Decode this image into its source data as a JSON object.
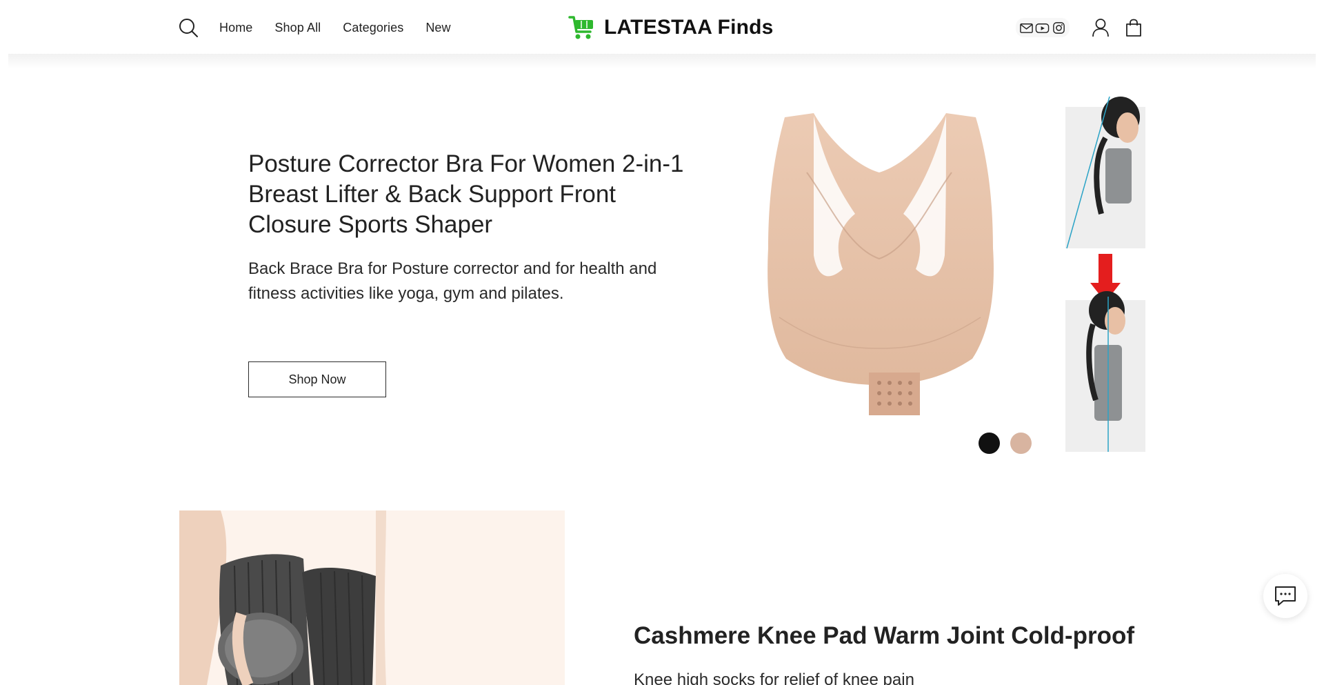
{
  "header": {
    "nav": [
      "Home",
      "Shop All",
      "Categories",
      "New"
    ],
    "logo_text": "LATESTAA Finds",
    "icons": {
      "search": "search-icon",
      "cart": "cart-icon",
      "email": "email-icon",
      "youtube": "youtube-icon",
      "instagram": "instagram-icon",
      "account": "account-icon",
      "bag": "bag-icon"
    },
    "brand_color": "#2eb82e"
  },
  "hero": {
    "title": "Posture Corrector Bra For Women 2-in-1 Breast Lifter & Back Support Front Closure Sports Shaper",
    "description": "Back Brace Bra for Posture corrector and for health and fitness activities like yoga, gym and pilates.",
    "button_label": "Shop Now",
    "swatches": [
      {
        "name": "black",
        "color": "#111111"
      },
      {
        "name": "beige",
        "color": "#d8b4a0"
      }
    ]
  },
  "section2": {
    "title": "Cashmere Knee Pad Warm Joint Cold-proof",
    "description": "Knee high socks for relief of knee pain"
  },
  "chat": {
    "icon": "chat-icon"
  }
}
